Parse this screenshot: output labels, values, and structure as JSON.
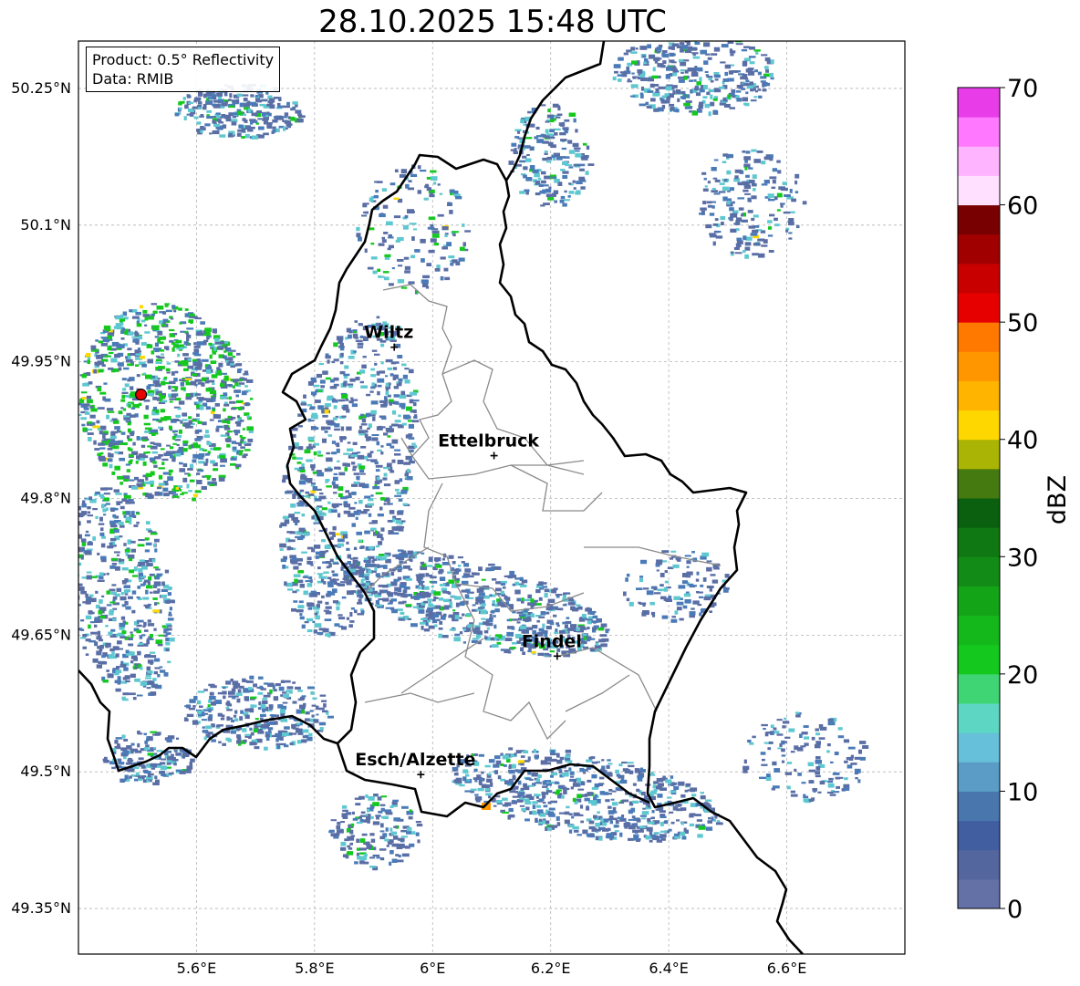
{
  "title": "28.10.2025 15:48 UTC",
  "info": {
    "product": "Product: 0.5° Reflectivity",
    "data": "Data: RMIB"
  },
  "axes": {
    "lon_ticks": [
      "5.6°E",
      "5.8°E",
      "6°E",
      "6.2°E",
      "6.4°E",
      "6.6°E"
    ],
    "lat_ticks": [
      "50.25°N",
      "50.1°N",
      "49.95°N",
      "49.8°N",
      "49.65°N",
      "49.5°N",
      "49.35°N"
    ]
  },
  "cities": [
    {
      "name": "Wiltz",
      "lon": 5.935,
      "lat": 49.966
    },
    {
      "name": "Ettelbruck",
      "lon": 6.104,
      "lat": 49.847
    },
    {
      "name": "Findel",
      "lon": 6.211,
      "lat": 49.627
    },
    {
      "name": "Esch/Alzette",
      "lon": 5.98,
      "lat": 49.497
    }
  ],
  "radar_site": {
    "lon": 5.506,
    "lat": 49.914
  },
  "colorbar": {
    "label": "dBZ",
    "ticks": [
      "0",
      "10",
      "20",
      "30",
      "40",
      "50",
      "60",
      "70"
    ],
    "colors": [
      "#6471a6",
      "#53669e",
      "#415ea1",
      "#4a76ae",
      "#5a9cc6",
      "#67c0da",
      "#5ed6c4",
      "#3fd575",
      "#14c81e",
      "#14b81a",
      "#14a418",
      "#128c16",
      "#0f7812",
      "#0a600e",
      "#447a10",
      "#aab404",
      "#ffd700",
      "#ffb400",
      "#ff9600",
      "#ff7800",
      "#e60000",
      "#c80000",
      "#a00000",
      "#780000",
      "#ffe0ff",
      "#ffb4ff",
      "#ff78ff",
      "#e83ce8"
    ]
  },
  "echo_colors": {
    "light": "#5a6ea6",
    "mid": "#4a7bb8",
    "cyan": "#5ec8d0",
    "green": "#14c81e",
    "yellow": "#ffd700",
    "orange": "#ff9600"
  }
}
